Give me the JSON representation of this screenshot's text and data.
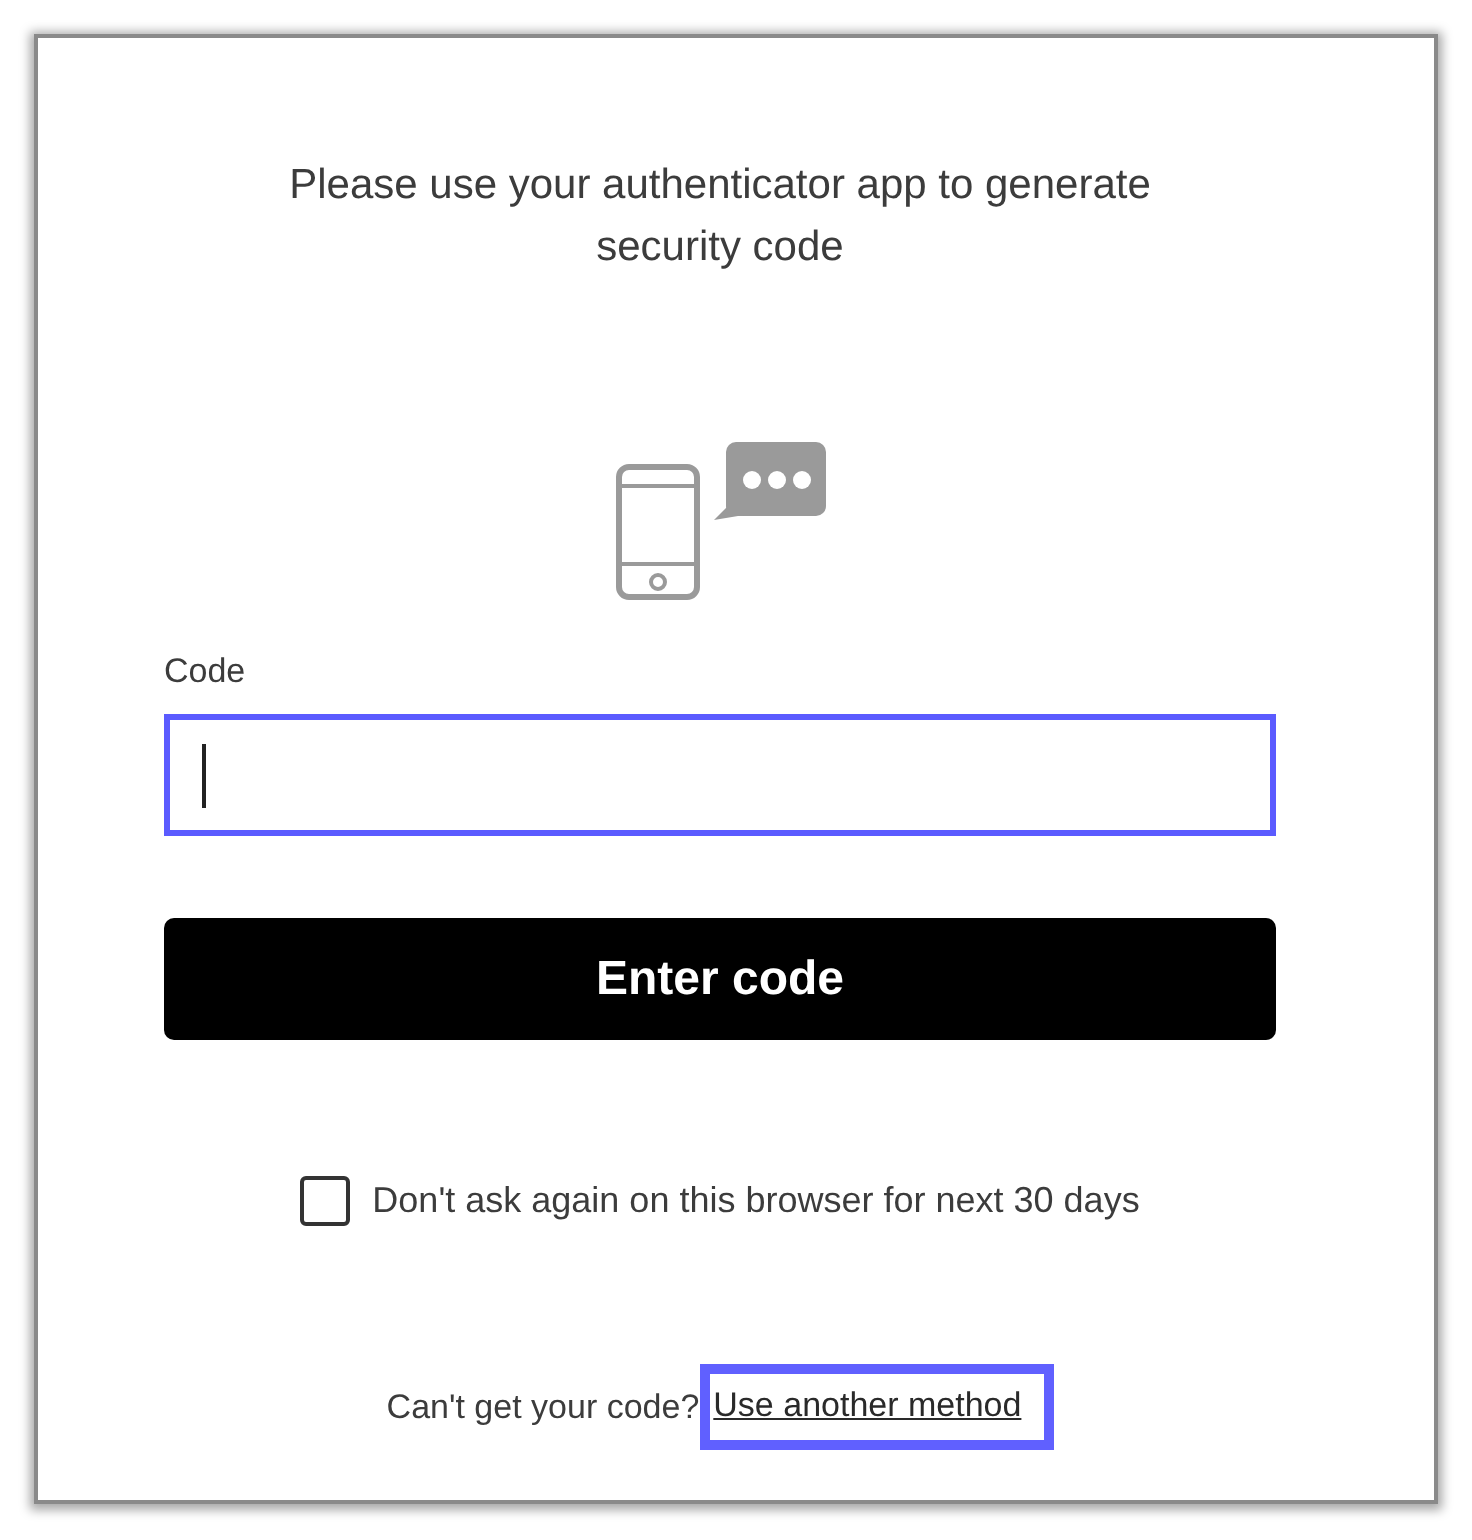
{
  "heading": "Please use your authenticator app to generate security code",
  "code_field": {
    "label": "Code",
    "focused": true
  },
  "submit_button": {
    "label": "Enter code"
  },
  "remember_option": {
    "label": "Don't ask again on this browser for next 30 days",
    "checked": false
  },
  "help": {
    "text": "Can't get your code?",
    "link": {
      "label": "Use another method",
      "focused": true
    }
  }
}
